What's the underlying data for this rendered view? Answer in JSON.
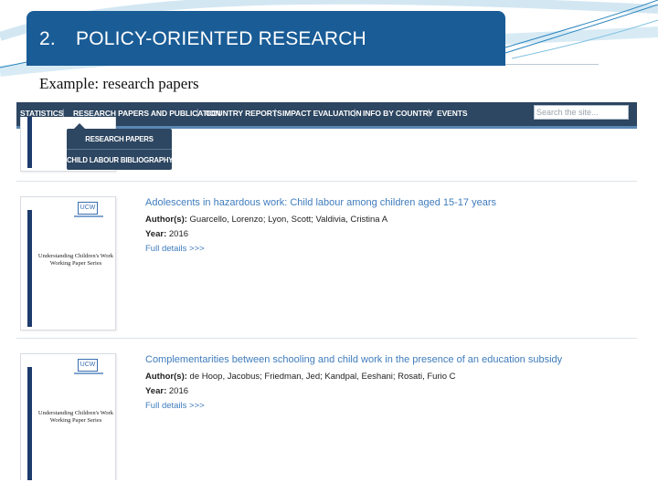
{
  "slide": {
    "number": "2.",
    "title": "POLICY-ORIENTED RESEARCH",
    "subtitle": "Example: research papers"
  },
  "navbar": {
    "items": [
      "STATISTICS",
      "RESEARCH PAPERS AND PUBLICATION",
      "COUNTRY REPORTS",
      "IMPACT EVALUATION",
      "INFO BY COUNTRY",
      "EVENTS"
    ],
    "separator": "|",
    "search_placeholder": "Search the site..."
  },
  "dropdown": {
    "items": [
      "RESEARCH PAPERS",
      "CHILD LABOUR BIBLIOGRAPHY"
    ]
  },
  "cover": {
    "logo": "UCW",
    "title_line1": "Understanding Children's Work",
    "title_line2": "Working Paper Series"
  },
  "papers": [
    {
      "title": "Adolescents in hazardous work: Child labour among children aged 15-17 years",
      "authors_label": "Author(s):",
      "authors": "Guarcello, Lorenzo; Lyon, Scott; Valdivia, Cristina A",
      "year_label": "Year:",
      "year": "2016",
      "details_link": "Full details >>>"
    },
    {
      "title": "Complementarities between schooling and child work in the presence of an education subsidy",
      "authors_label": "Author(s):",
      "authors": "de Hoop, Jacobus; Friedman, Jed; Kandpal, Eeshani; Rosati, Furio C",
      "year_label": "Year:",
      "year": "2016",
      "details_link": "Full details >>>"
    }
  ],
  "colors": {
    "title_bar": "#1a5c96",
    "navbar": "#2d4661",
    "link": "#3f7cbc",
    "cover_stripe": "#1e3b6e"
  }
}
